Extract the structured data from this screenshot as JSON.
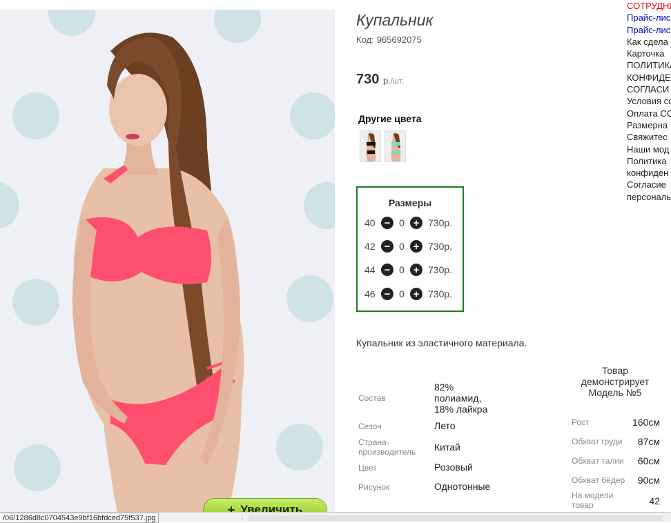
{
  "product": {
    "title": "Купальник",
    "code_label": "Код:",
    "code": "965692075",
    "price": "730",
    "price_unit": "р.",
    "price_per": "/шт.",
    "other_colors_label": "Другие цвета",
    "zoom_label": "Увеличить",
    "description": "Купальник из эластичного материала."
  },
  "sizes": {
    "title": "Размеры",
    "rows": [
      {
        "size": "40",
        "qty": "0",
        "price": "730р."
      },
      {
        "size": "42",
        "qty": "0",
        "price": "730р."
      },
      {
        "size": "44",
        "qty": "0",
        "price": "730р."
      },
      {
        "size": "46",
        "qty": "0",
        "price": "730р."
      }
    ]
  },
  "properties": [
    {
      "key": "Состав",
      "value": "82%\nполиамид,\n18% лайкра"
    },
    {
      "key": "Сезон",
      "value": "Лето"
    },
    {
      "key": "Страна-\nпроизводитель",
      "value": "Китай"
    },
    {
      "key": "Цвет",
      "value": "Розовый"
    },
    {
      "key": "Рисунок",
      "value": "Однотонные"
    }
  ],
  "model": {
    "heading": "Товар\nдемонстрирует\nМодель №5",
    "rows": [
      {
        "key": "Рост",
        "value": "160см"
      },
      {
        "key": "Обхват груди",
        "value": "87см"
      },
      {
        "key": "Обхват талии",
        "value": "60см"
      },
      {
        "key": "Обхват бёдер",
        "value": "90см"
      },
      {
        "key": "На модели\nтовар",
        "value": "42"
      }
    ]
  },
  "menu": [
    {
      "label": "СОТРУДНИ",
      "color": "#ee0000"
    },
    {
      "label": "Прайс-лис",
      "color": "#0000cc"
    },
    {
      "label": "Прайс-лис",
      "color": "#0000cc"
    },
    {
      "label": "Как сдела",
      "color": "#222222"
    },
    {
      "label": "Карточка",
      "color": "#222222"
    },
    {
      "label": "ПОЛИТИКА",
      "color": "#222222"
    },
    {
      "label": "КОНФИДЕ",
      "color": "#222222"
    },
    {
      "label": "СОГЛАСИ",
      "color": "#222222"
    },
    {
      "label": "Условия сс",
      "color": "#222222"
    },
    {
      "label": "Оплата СС",
      "color": "#222222"
    },
    {
      "label": "Размерна",
      "color": "#222222"
    },
    {
      "label": "Свяжитес",
      "color": "#222222"
    },
    {
      "label": "Наши мод",
      "color": "#222222"
    },
    {
      "label": "Политика",
      "color": "#222222"
    },
    {
      "label": "конфиден",
      "color": "#222222"
    },
    {
      "label": "Согласие",
      "color": "#222222"
    },
    {
      "label": "персональ",
      "color": "#222222"
    }
  ],
  "statusbar": {
    "url": "/06/1286d8c0704543e9bf16bfdced75f537.jpg"
  },
  "colors": {
    "sizes_border": "#1e7d1e",
    "zoom_button": "#a6d836",
    "swimsuit": "#ff4f6e"
  },
  "icons": {
    "minus": "minus-circle-icon",
    "plus": "plus-circle-icon",
    "zoom": "plus-icon"
  }
}
